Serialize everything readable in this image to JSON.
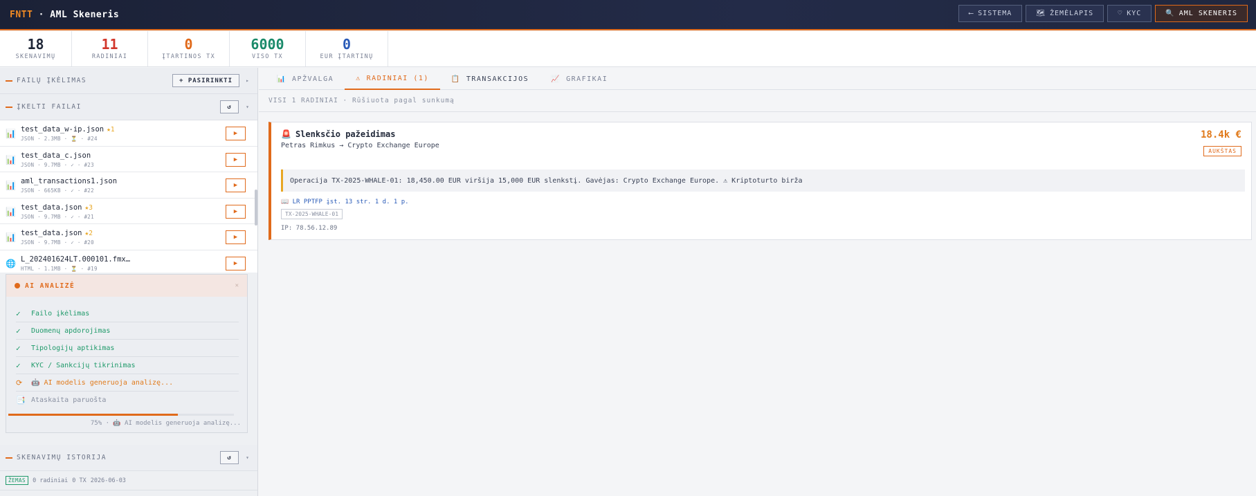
{
  "header": {
    "brand_accent": "FNTT",
    "brand_sep": " · ",
    "brand_title": "AML Skeneris",
    "nav": [
      {
        "icon": "⟵",
        "label": "SISTEMA"
      },
      {
        "icon": "🗺",
        "label": "ŽEMĖLAPIS"
      },
      {
        "icon": "♡",
        "label": "KYC"
      },
      {
        "icon": "🔍",
        "label": "AML SKENERIS"
      }
    ]
  },
  "stats": [
    {
      "value": "18",
      "label": "SKENAVIMŲ",
      "color": "#1f2637"
    },
    {
      "value": "11",
      "label": "RADINIAI",
      "color": "#d2362b"
    },
    {
      "value": "0",
      "label": "ĮTARTINOS TX",
      "color": "#e06a1b"
    },
    {
      "value": "6000",
      "label": "VISO TX",
      "color": "#1a8a6a"
    },
    {
      "value": "0",
      "label": "EUR ĮTARTINŲ",
      "color": "#2a5bb8"
    }
  ],
  "upload": {
    "title": "FAILŲ ĮKĖLIMAS",
    "button": "+ PASIRINKTI",
    "caret": "▸"
  },
  "uploaded": {
    "title": "ĮKELTI FAILAI",
    "refresh": "↺",
    "caret": "▾"
  },
  "files": [
    {
      "icon": "📊",
      "name": "test_data_w-ip.json",
      "star": "★1",
      "meta": "JSON · 2.3MB · ⏳ · #24"
    },
    {
      "icon": "📊",
      "name": "test_data_c.json",
      "star": "",
      "meta": "JSON · 9.7MB · ✓ · #23"
    },
    {
      "icon": "📊",
      "name": "aml_transactions1.json",
      "star": "",
      "meta": "JSON · 665KB · ✓ · #22"
    },
    {
      "icon": "📊",
      "name": "test_data.json",
      "star": "★3",
      "meta": "JSON · 9.7MB · ✓ · #21"
    },
    {
      "icon": "📊",
      "name": "test_data.json",
      "star": "★2",
      "meta": "JSON · 9.7MB · ✓ · #20"
    },
    {
      "icon": "🌐",
      "name": "L_202401624LT.000101.fmx…",
      "star": "",
      "meta": "HTML · 1.1MB · ⏳ · #19"
    }
  ],
  "play_icon": "▶",
  "ai": {
    "title": "AI ANALIZĖ",
    "close": "✕",
    "steps": [
      {
        "icon": "✓",
        "label": "Failo įkėlimas",
        "state": "done"
      },
      {
        "icon": "✓",
        "label": "Duomenų apdorojimas",
        "state": "done"
      },
      {
        "icon": "✓",
        "label": "Tipologijų aptikimas",
        "state": "done"
      },
      {
        "icon": "✓",
        "label": "KYC / Sankcijų tikrinimas",
        "state": "done"
      },
      {
        "icon": "⟳",
        "label": "🤖 AI modelis generuoja analizę...",
        "state": "run"
      },
      {
        "icon": "📑",
        "label": "Ataskaita paruošta",
        "state": "pend"
      }
    ],
    "progress": 0.75,
    "progress_text": "75% · 🤖 AI modelis generuoja analizę..."
  },
  "history": {
    "title": "SKENAVIMŲ ISTORIJA",
    "refresh": "↺",
    "caret": "▾",
    "row": {
      "badge": "ŽEMAS",
      "findings": "0 radiniai",
      "tx": "0 TX",
      "date": "2026-06-03"
    }
  },
  "tabs": [
    {
      "icon": "📊",
      "label": "APŽVALGA"
    },
    {
      "icon": "⚠",
      "label": "RADINIAI (1)"
    },
    {
      "icon": "📋",
      "label": "TRANSAKCIJOS"
    },
    {
      "icon": "📈",
      "label": "GRAFIKAI"
    }
  ],
  "subheader": "VISI 1 RADINIAI · Rūšiuota pagal sunkumą",
  "finding": {
    "icon": "🚨",
    "title": "Slenksčio pažeidimas",
    "parties": "Petras Rimkus → Crypto Exchange Europe",
    "amount": "18.4k €",
    "severity": "AUKŠTAS",
    "description": "Operacija TX-2025-WHALE-01: 18,450.00 EUR viršija 15,000 EUR slenkstį. Gavėjas: Crypto Exchange Europe. ⚠ Kriptoturto birža",
    "law": "📖 LR PPTFP įst. 13 str. 1 d. 1 p.",
    "tx_id": "TX-2025-WHALE-01",
    "ip": "IP: 78.56.12.89"
  }
}
